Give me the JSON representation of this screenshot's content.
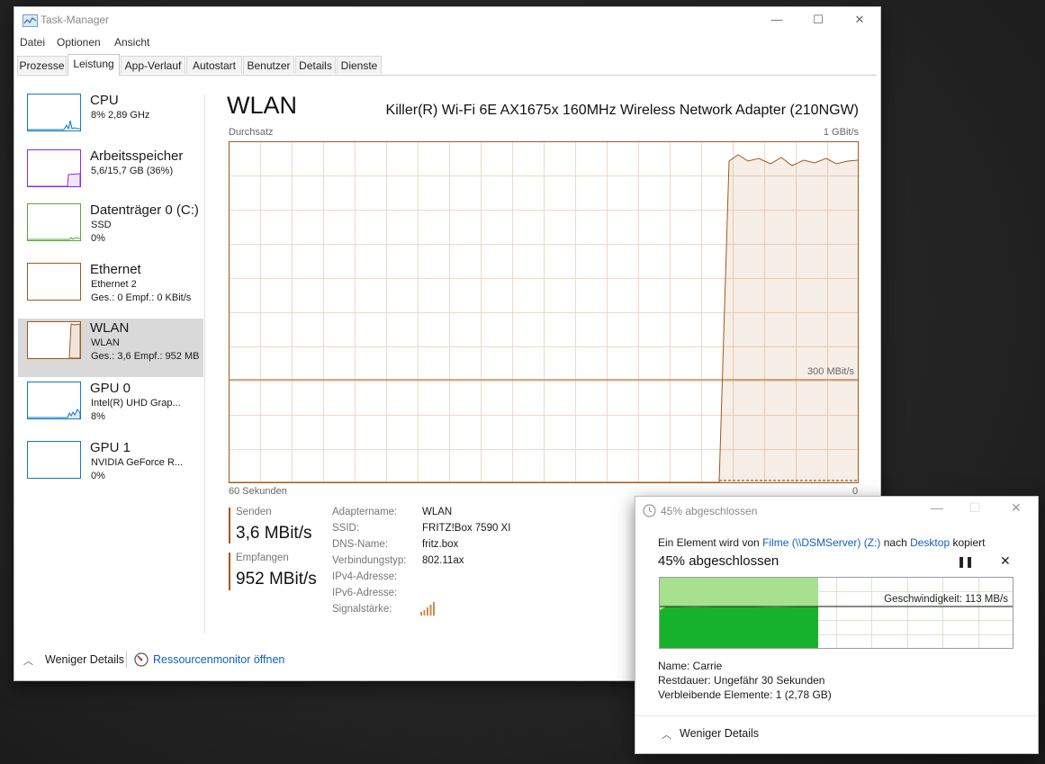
{
  "window": {
    "title": "Task-Manager",
    "minimize": "—",
    "maximize": "☐",
    "close": "✕"
  },
  "menu": [
    "Datei",
    "Optionen",
    "Ansicht"
  ],
  "tabs": [
    "Prozesse",
    "Leistung",
    "App-Verlauf",
    "Autostart",
    "Benutzer",
    "Details",
    "Dienste"
  ],
  "active_tab": "Leistung",
  "sidebar": [
    {
      "name": "CPU",
      "line2": "8%  2,89 GHz",
      "line3": "",
      "color": "#1479c6"
    },
    {
      "name": "Arbeitsspeicher",
      "line2": "5,6/15,7 GB (36%)",
      "line3": "",
      "color": "#8a2be2"
    },
    {
      "name": "Datenträger 0 (C:)",
      "line2": "SSD",
      "line3": "0%",
      "color": "#4caf32"
    },
    {
      "name": "Ethernet",
      "line2": "Ethernet 2",
      "line3": "Ges.: 0 Empf.: 0 KBit/s",
      "color": "#a25a18"
    },
    {
      "name": "WLAN",
      "line2": "WLAN",
      "line3": "Ges.: 3,6 Empf.: 952 MB",
      "color": "#a25a18"
    },
    {
      "name": "GPU 0",
      "line2": "Intel(R) UHD Grap...",
      "line3": "8%",
      "color": "#1479c6"
    },
    {
      "name": "GPU 1",
      "line2": "NVIDIA GeForce R...",
      "line3": "0%",
      "color": "#1479c6"
    }
  ],
  "selected_item": "WLAN",
  "main": {
    "title": "WLAN",
    "adapter": "Killer(R) Wi-Fi 6E AX1675x 160MHz Wireless Network Adapter (210NGW)",
    "graph_label": "Durchsatz",
    "graph_max": "1 GBit/s",
    "graph_mid": "300 MBit/s",
    "graph_left": "60 Sekunden",
    "graph_right": "0",
    "send_label": "Senden",
    "send_value": "3,6 MBit/s",
    "recv_label": "Empfangen",
    "recv_value": "952 MBit/s",
    "props": [
      {
        "k": "Adaptername:",
        "v": "WLAN"
      },
      {
        "k": "SSID:",
        "v": "FRITZ!Box 7590 XI"
      },
      {
        "k": "DNS-Name:",
        "v": "fritz.box"
      },
      {
        "k": "Verbindungstyp:",
        "v": "802.11ax"
      },
      {
        "k": "IPv4-Adresse:",
        "v": ""
      },
      {
        "k": "IPv6-Adresse:",
        "v": ""
      },
      {
        "k": "Signalstärke:",
        "v": ""
      }
    ],
    "signal_bars": 5
  },
  "footer": {
    "fewer_details": "Weniger Details",
    "resource_monitor": "Ressourcenmonitor öffnen"
  },
  "copy_dialog": {
    "title": "45% abgeschlossen",
    "line_pre": "Ein Element wird von ",
    "source": "Filme (\\\\DSMServer) (Z:)",
    "line_mid": " nach ",
    "dest": "Desktop",
    "line_post": " kopiert",
    "percent_text": "45% abgeschlossen",
    "progress": 0.45,
    "speed": "Geschwindigkeit: 113 MB/s",
    "name": "Name:  Carrie",
    "remaining_time": "Restdauer:  Ungefähr 30 Sekunden",
    "remaining_items": "Verbleibende Elemente:  1 (2,78 GB)",
    "fewer_details": "Weniger Details"
  },
  "colors": {
    "accent_network": "#a25a18",
    "progress_green": "#17b22c",
    "progress_light": "#a7e08f",
    "link": "#1060c8"
  }
}
